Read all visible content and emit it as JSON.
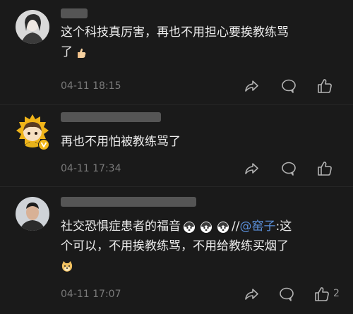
{
  "comments": [
    {
      "text_line1": "这个科技真厉害，再也不用担心要挨教练骂",
      "text_line2": "了",
      "emoji_after": "thumbs-up-icon",
      "time": "04-11 18:15",
      "likes": ""
    },
    {
      "text_line1": "再也不用怕被教练骂了",
      "time": "04-11 17:34",
      "likes": ""
    },
    {
      "text_line1_prefix": "社交恐惧症患者的福音",
      "emojis_inline": [
        "husky-icon",
        "husky-icon",
        "husky-icon"
      ],
      "repost_separator": "//",
      "mention": "@窑子",
      "text_line1_suffix": ":这",
      "text_line2": "个可以，不用挨教练骂，不用给教练买烟了",
      "emoji_line3": "doge-icon",
      "time": "04-11 17:07",
      "likes": "2"
    }
  ],
  "colors": {
    "background": "#1a1a1a",
    "text": "#ececec",
    "meta": "#7a7a7a",
    "mention": "#5a8fd9"
  }
}
